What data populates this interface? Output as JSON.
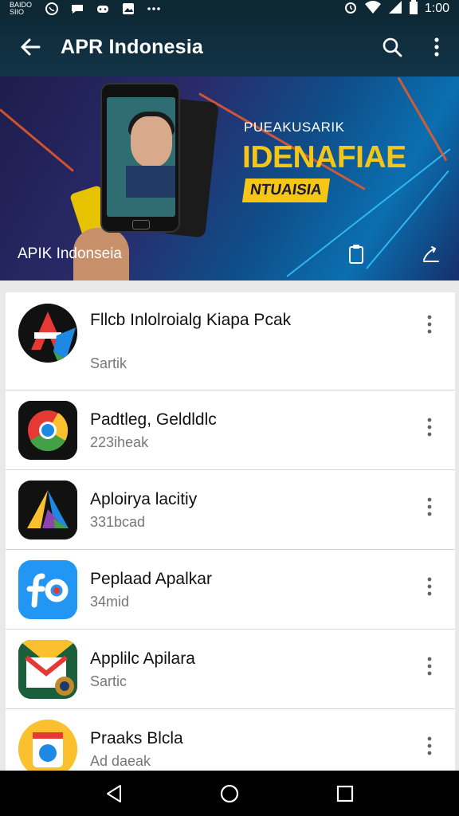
{
  "status_bar": {
    "carrier": "BAIDO SIIO",
    "time": "1:00",
    "icons": [
      "whatsapp-icon",
      "chat-icon",
      "game-icon",
      "gallery-icon",
      "more-dots-icon",
      "alarm-icon",
      "wifi-icon",
      "signal-icon",
      "battery-icon"
    ]
  },
  "app_bar": {
    "title": "APR Indonesia",
    "back_icon": "arrow-left-icon",
    "search_icon": "search-icon",
    "menu_icon": "overflow-menu-icon"
  },
  "banner": {
    "heading": "PUEAKUSARIK",
    "big_text": "IDENAFIAE",
    "tag": "NTUAISIA",
    "label": "APIK Indonseia",
    "colors": {
      "accent": "#f5c518",
      "ray": "#f05a28",
      "ray_blue": "#36c6ff"
    }
  },
  "apps": [
    {
      "name": "Fllcb Inlolroialg Kiapa Pcak",
      "sub": "Sartik",
      "icon": "red-a-app-icon"
    },
    {
      "name": "Padtleg, Geldldlc",
      "sub": "223iheak",
      "icon": "chrome-style-icon"
    },
    {
      "name": "Aploirya lacitiy",
      "sub": "331bcad",
      "icon": "triangle-app-icon"
    },
    {
      "name": "Peplaad Apalkar",
      "sub": "34mid",
      "icon": "blue-fo-app-icon"
    },
    {
      "name": "Applilc Apilara",
      "sub": "Sartic",
      "icon": "gmail-style-icon"
    },
    {
      "name": "Praaks Blcla",
      "sub": "Ad daeak",
      "icon": "yellow-circle-app-icon"
    }
  ],
  "nav_bar": {
    "back": "nav-back-icon",
    "home": "nav-home-icon",
    "recents": "nav-recents-icon"
  }
}
